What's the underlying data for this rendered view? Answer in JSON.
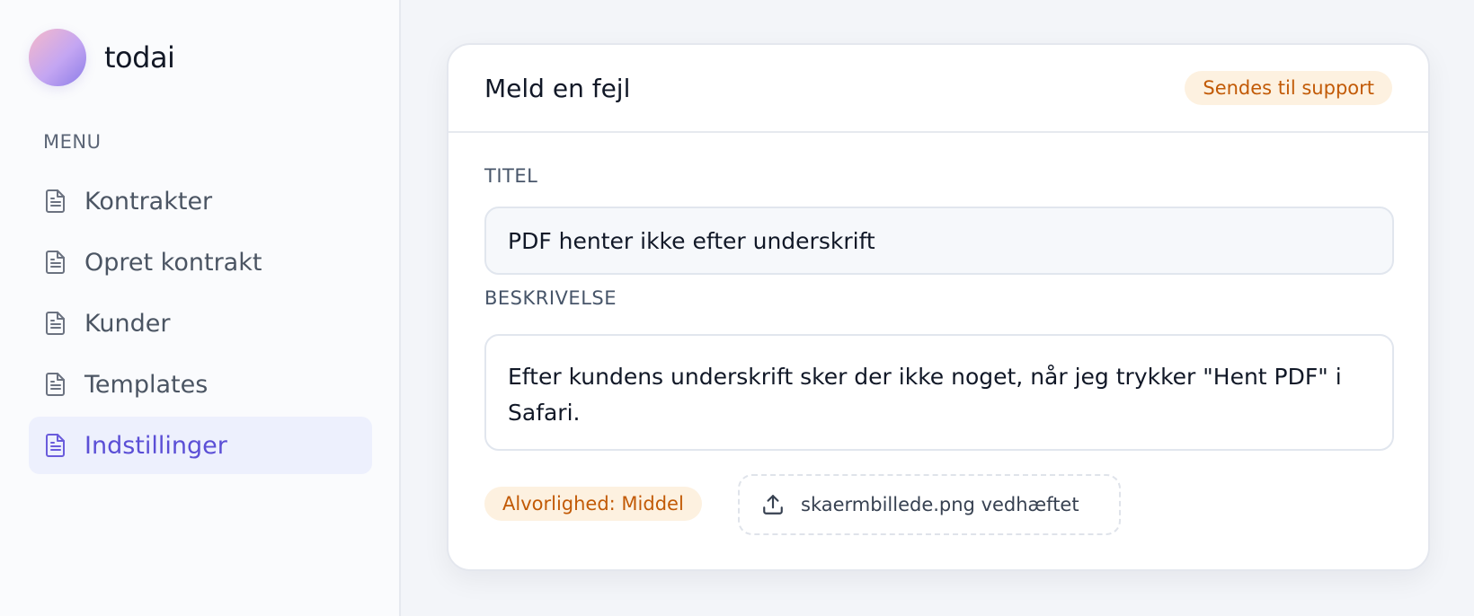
{
  "brand": {
    "name": "todai"
  },
  "sidebar": {
    "menu_label": "MENU",
    "items": [
      {
        "label": "Kontrakter",
        "icon": "document-icon",
        "active": false
      },
      {
        "label": "Opret kontrakt",
        "icon": "document-icon",
        "active": false
      },
      {
        "label": "Kunder",
        "icon": "document-icon",
        "active": false
      },
      {
        "label": "Templates",
        "icon": "document-icon",
        "active": false
      },
      {
        "label": "Indstillinger",
        "icon": "document-icon",
        "active": true
      }
    ]
  },
  "report": {
    "title": "Meld en fejl",
    "status_badge": "Sendes til support",
    "title_label": "TITEL",
    "title_value": "PDF henter ikke efter underskrift",
    "description_label": "BESKRIVELSE",
    "description_value": "Efter kundens underskrift sker der ikke noget, når jeg trykker \"Hent PDF\" i Safari.",
    "severity": "Alvorlighed: Middel",
    "attachment": "skaermbillede.png vedhæftet",
    "attachment_icon": "upload-icon"
  },
  "colors": {
    "accent": "#5b4fd6",
    "active_bg": "#edf0fd",
    "badge_bg": "#fdf1e0",
    "badge_text": "#c25a06"
  }
}
